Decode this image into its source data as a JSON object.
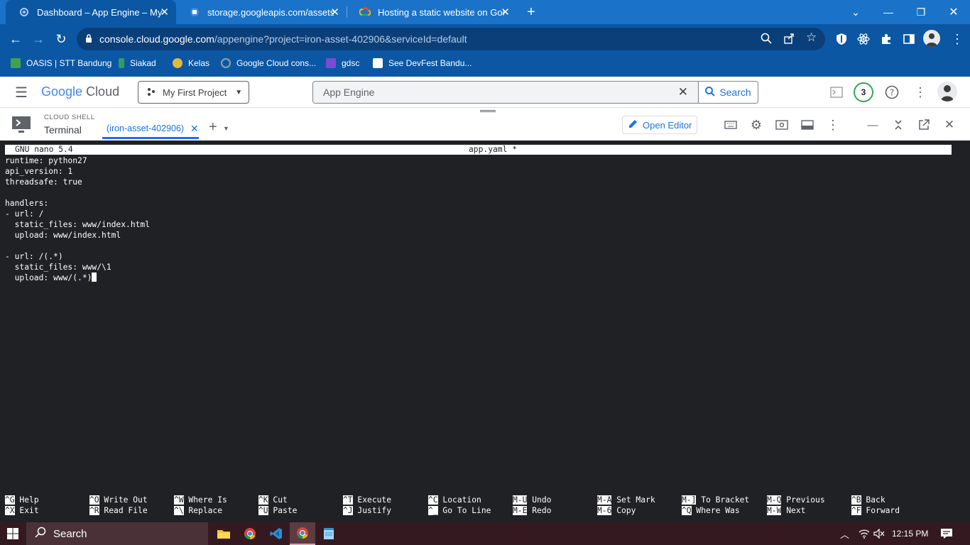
{
  "browser": {
    "tabs": [
      {
        "title": "Dashboard – App Engine – My First",
        "active": true
      },
      {
        "title": "storage.googleapis.com/assets_",
        "active": false
      },
      {
        "title": "Hosting a static website on Goog",
        "active": false
      }
    ],
    "new_tab_label": "+",
    "url_host": "console.cloud.google.com",
    "url_path": "/appengine?project=iron-asset-402906&serviceId=default",
    "bookmarks": [
      {
        "label": "OASIS | STT Bandung",
        "color": "#3fa34d"
      },
      {
        "label": "Siakad",
        "color": "#0b57a4"
      },
      {
        "label": "Kelas",
        "color": "#e1b93a"
      },
      {
        "label": "Google Cloud cons...",
        "color": "#9aa0a6"
      },
      {
        "label": "gdsc",
        "color": "#7b4bd6"
      },
      {
        "label": "See DevFest Bandu...",
        "color": "#ffffff"
      }
    ]
  },
  "gcp": {
    "logo_google": "Google",
    "logo_cloud": "Cloud",
    "project": "My First Project",
    "search_value": "App Engine",
    "search_button": "Search",
    "notification_count": "3"
  },
  "shell": {
    "heading": "CLOUD SHELL",
    "title": "Terminal",
    "tab_label": "(iron-asset-402906)",
    "open_editor": "Open Editor"
  },
  "nano": {
    "version": "GNU nano 5.4",
    "filename": "app.yaml *",
    "lines": [
      "runtime: python27",
      "api_version: 1",
      "threadsafe: true",
      "",
      "handlers:",
      "- url: /",
      "  static_files: www/index.html",
      "  upload: www/index.html",
      "",
      "- url: /(.*)",
      "  static_files: www/\\1",
      "  upload: www/(.*)"
    ],
    "shortcuts_row1": [
      {
        "key": "^G",
        "label": "Help"
      },
      {
        "key": "^O",
        "label": "Write Out"
      },
      {
        "key": "^W",
        "label": "Where Is"
      },
      {
        "key": "^K",
        "label": "Cut"
      },
      {
        "key": "^T",
        "label": "Execute"
      },
      {
        "key": "^C",
        "label": "Location"
      },
      {
        "key": "M-U",
        "label": "Undo"
      },
      {
        "key": "M-A",
        "label": "Set Mark"
      },
      {
        "key": "M-]",
        "label": "To Bracket"
      },
      {
        "key": "M-Q",
        "label": "Previous"
      },
      {
        "key": "^B",
        "label": "Back"
      }
    ],
    "shortcuts_row2": [
      {
        "key": "^X",
        "label": "Exit"
      },
      {
        "key": "^R",
        "label": "Read File"
      },
      {
        "key": "^\\",
        "label": "Replace"
      },
      {
        "key": "^U",
        "label": "Paste"
      },
      {
        "key": "^J",
        "label": "Justify"
      },
      {
        "key": "^_",
        "label": "Go To Line"
      },
      {
        "key": "M-E",
        "label": "Redo"
      },
      {
        "key": "M-6",
        "label": "Copy"
      },
      {
        "key": "^Q",
        "label": "Where Was"
      },
      {
        "key": "M-W",
        "label": "Next"
      },
      {
        "key": "^F",
        "label": "Forward"
      }
    ]
  },
  "taskbar": {
    "search_label": "Search",
    "time": "12:15 PM"
  }
}
